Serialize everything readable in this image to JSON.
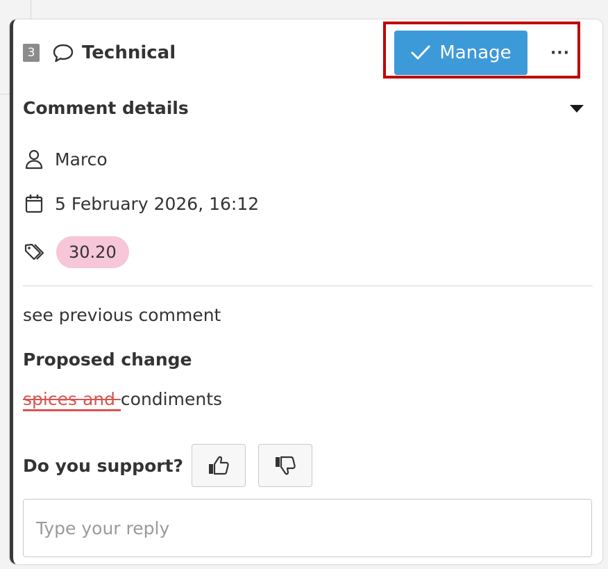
{
  "comment": {
    "number": "3",
    "type_label": "Technical",
    "manage_label": "Manage",
    "more_label": "···",
    "details_heading": "Comment details",
    "author": "Marco",
    "date": "5 February 2026, 16:12",
    "tag": "30.20",
    "body": "see previous comment",
    "proposed_heading": "Proposed change",
    "proposed_deleted": "spices and ",
    "proposed_inserted": "condiments",
    "support_label": "Do you support?",
    "reply_placeholder": "Type your reply"
  },
  "colors": {
    "manage_button": "#3d9ad9",
    "highlight_border": "#c00000",
    "tag_background": "#f7c6d8",
    "deleted_text": "#d9534f"
  },
  "icons": {
    "type": "comment-bubble-icon",
    "manage": "checkmark-icon",
    "details_toggle": "caret-down-icon",
    "author": "user-icon",
    "date": "calendar-icon",
    "tag": "tag-icon",
    "support_yes": "thumbs-up-icon",
    "support_no": "thumbs-down-icon"
  }
}
